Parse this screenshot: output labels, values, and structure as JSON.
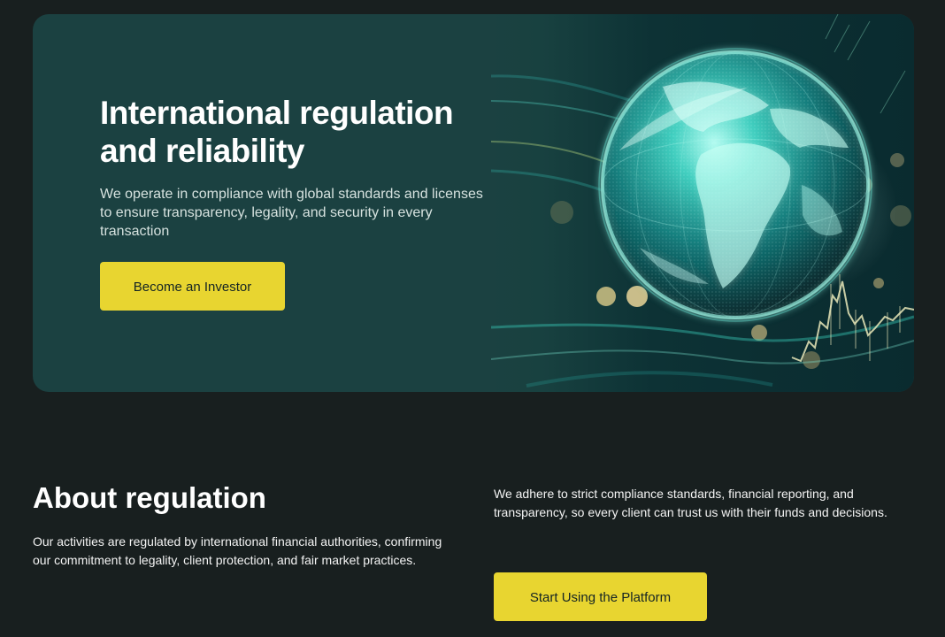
{
  "hero": {
    "title": "International regulation and reliability",
    "description": "We operate in compliance with global standards and licenses to ensure transparency, legality, and security in every transaction",
    "button_label": "Become an Investor",
    "visual": "glowing-globe-financial-chart",
    "colors": {
      "background": "#1b4141",
      "accent": "#e8d530",
      "glow": "#38d8c4"
    }
  },
  "about": {
    "title": "About regulation",
    "description": "Our activities are regulated by international financial authorities, confirming our commitment to legality, client protection, and fair market practices.",
    "right_text": "We adhere to strict compliance standards, financial reporting, and transparency, so every client can trust us with their funds and decisions.",
    "button_label": "Start Using the Platform"
  },
  "page": {
    "background": "#181f1f"
  }
}
